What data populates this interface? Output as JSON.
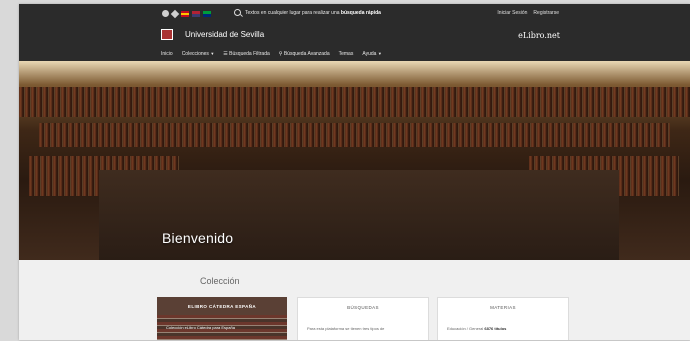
{
  "topbar": {
    "search_text_prefix": "Textos en cualquier lugar para realizar una",
    "search_text_bold": "búsqueda rápida",
    "login": "Iniciar Sesión",
    "register": "Registrarse"
  },
  "header": {
    "university": "Universidad de Sevilla",
    "brand": "eLibro.net"
  },
  "nav": {
    "items": [
      {
        "label": "Inicio"
      },
      {
        "label": "Colecciones"
      },
      {
        "label": "Búsqueda Filtrada"
      },
      {
        "label": "Búsqueda Avanzada"
      },
      {
        "label": "Temas"
      },
      {
        "label": "Ayuda"
      }
    ]
  },
  "hero": {
    "title": "Bienvenido"
  },
  "section": {
    "title": "Colección",
    "cards": [
      {
        "title": "ELIBRO CÁTEDRA ESPAÑA",
        "line": "Colección eLibro Cátedra para España"
      },
      {
        "title": "BÚSQUEDAS",
        "line": "Para esta plataforma se tienen tres tipos de"
      },
      {
        "title": "MATERIAS",
        "line_prefix": "Educación / General",
        "line_num": "6876 títulos"
      }
    ]
  },
  "colors": {
    "topbar_bg": "#2b2b2b",
    "section_bg": "#f0f0f0",
    "card_dark_bg": "#5a4035"
  }
}
